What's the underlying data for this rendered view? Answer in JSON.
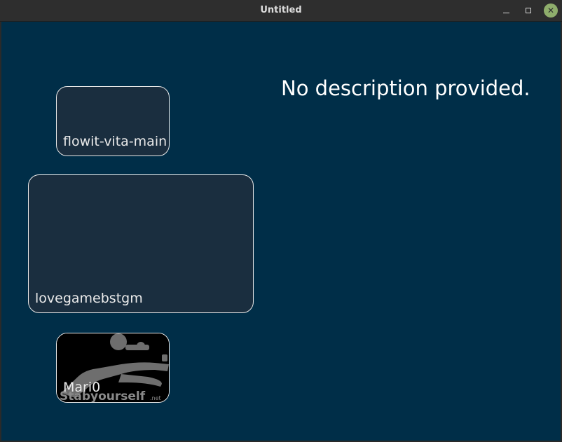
{
  "window": {
    "title": "Untitled"
  },
  "games": [
    {
      "label": "flowit-vita-main",
      "selected": false
    },
    {
      "label": "lovegamebstgm",
      "selected": true
    },
    {
      "label": "Mari0",
      "thumbnail_text": "Stabyourself",
      "thumbnail_text_suffix": ".net"
    }
  ],
  "details": {
    "description": "No description provided."
  },
  "colors": {
    "background": "#002e48",
    "card_fill": "#1a2e3f",
    "card_border": "#e8e8e8",
    "text": "#ffffff",
    "close_button": "#8fae6c"
  }
}
